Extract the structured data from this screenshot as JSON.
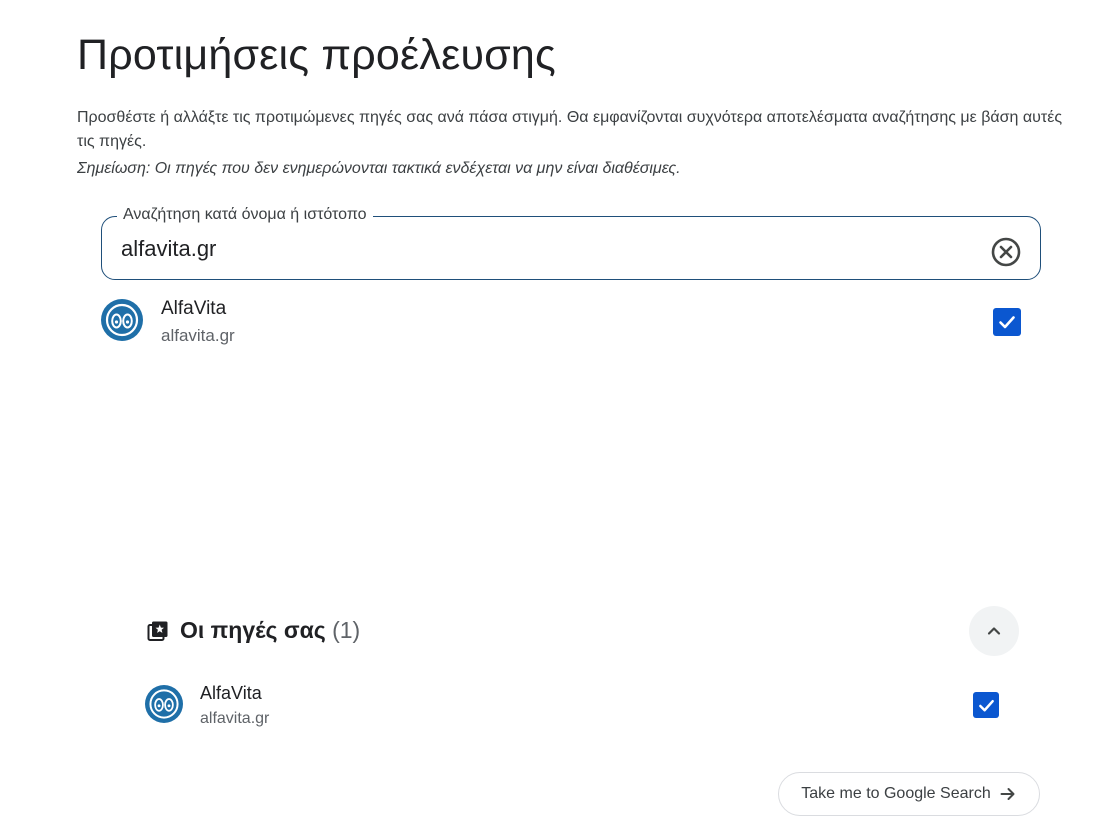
{
  "header": {
    "title": "Προτιμήσεις προέλευσης",
    "description": "Προσθέστε ή αλλάξτε τις προτιμώμενες πηγές σας ανά πάσα στιγμή. Θα εμφανίζονται συχνότερα αποτελέσματα αναζήτησης με βάση αυτές τις πηγές.",
    "note": "Σημείωση: Οι πηγές που δεν ενημερώνονται τακτικά ενδέχεται να μην είναι διαθέσιμες."
  },
  "search": {
    "label": "Αναζήτηση κατά όνομα ή ιστότοπο",
    "value": "alfavita.gr",
    "clear_icon": "clear-circle-x-icon"
  },
  "search_results": [
    {
      "name": "AlfaVita",
      "domain": "alfavita.gr",
      "checked": true,
      "logo_icon": "alfavita-logo"
    }
  ],
  "your_sources": {
    "icon": "sources-bookmark-icon",
    "title": "Οι πηγές σας",
    "count": "(1)",
    "toggle_icon": "chevron-up-icon",
    "items": [
      {
        "name": "AlfaVita",
        "domain": "alfavita.gr",
        "checked": true,
        "logo_icon": "alfavita-logo"
      }
    ]
  },
  "cta": {
    "label": "Take me to Google Search",
    "icon": "arrow-right-icon"
  },
  "colors": {
    "accent": "#0b57d0",
    "logo_blue": "#1f6fa8",
    "field_border": "#1f4f7a"
  }
}
